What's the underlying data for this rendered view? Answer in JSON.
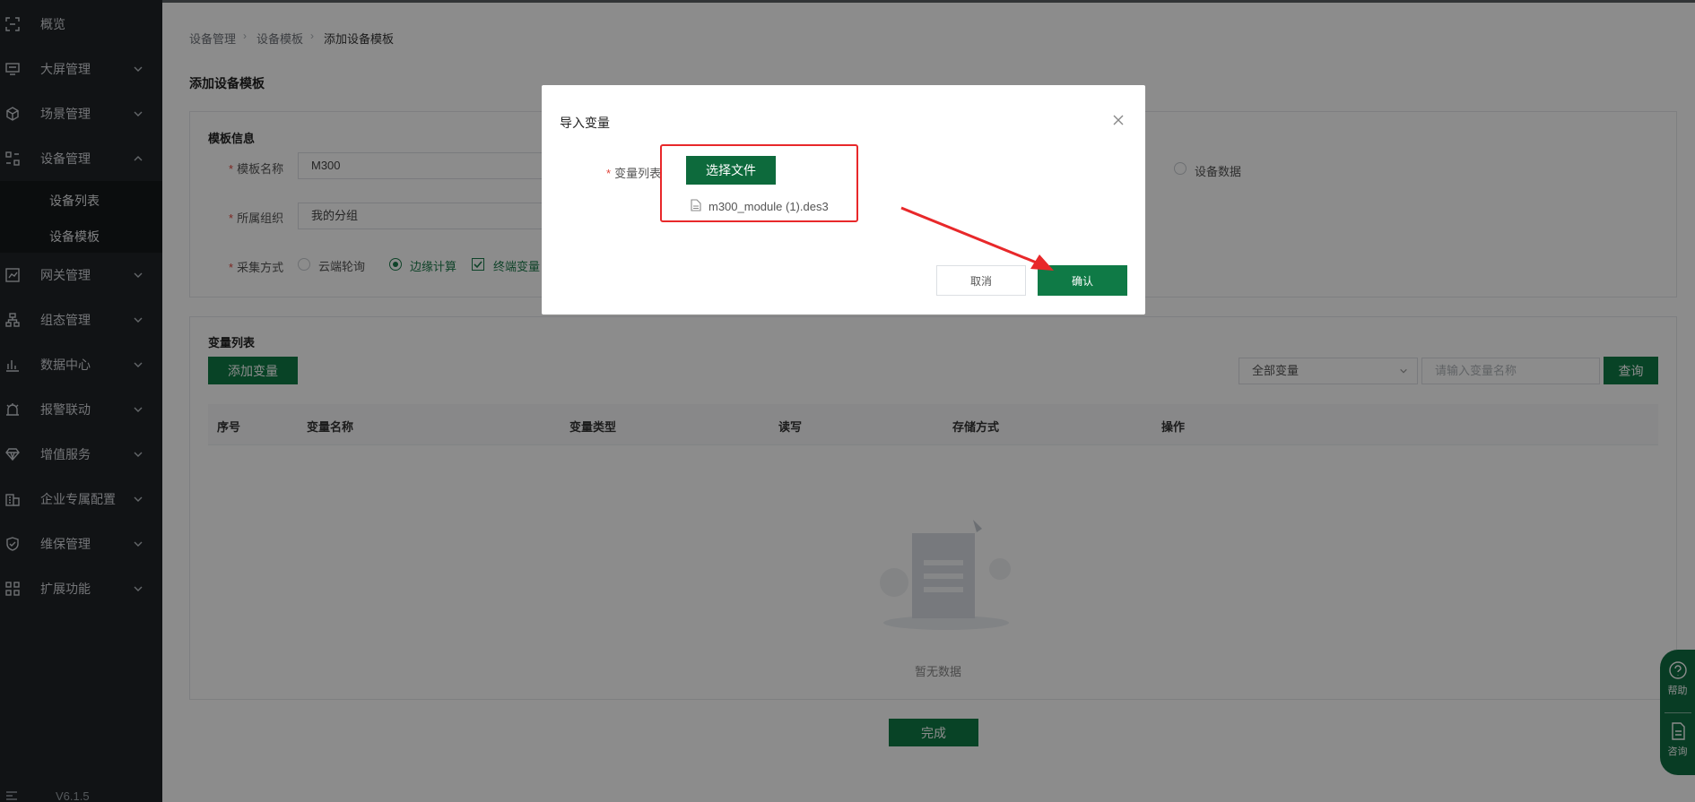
{
  "sidebar": {
    "items": [
      {
        "label": "概览",
        "icon": "scan-icon"
      },
      {
        "label": "大屏管理",
        "icon": "monitor-icon"
      },
      {
        "label": "场景管理",
        "icon": "cube-icon"
      },
      {
        "label": "设备管理",
        "icon": "device-grid-icon"
      },
      {
        "label": "网关管理",
        "icon": "chart-box-icon"
      },
      {
        "label": "组态管理",
        "icon": "hierarchy-icon"
      },
      {
        "label": "数据中心",
        "icon": "bar-chart-icon"
      },
      {
        "label": "报警联动",
        "icon": "alarm-icon"
      },
      {
        "label": "增值服务",
        "icon": "diamond-icon"
      },
      {
        "label": "企业专属配置",
        "icon": "building-icon"
      },
      {
        "label": "维保管理",
        "icon": "shield-icon"
      },
      {
        "label": "扩展功能",
        "icon": "apps-icon"
      }
    ],
    "sub_items": [
      "设备列表",
      "设备模板"
    ],
    "version": "V6.1.5"
  },
  "breadcrumb": [
    "设备管理",
    "设备模板",
    "添加设备模板"
  ],
  "page_title": "添加设备模板",
  "template_info": {
    "title": "模板信息",
    "name_label": "模板名称",
    "name_value": "M300",
    "org_label": "所属组织",
    "org_value": "我的分组",
    "mode_label": "采集方式",
    "mode_cloud": "云端轮询",
    "mode_edge": "边缘计算",
    "terminal_var": "终端变量",
    "device_data": "设备数据"
  },
  "var_list": {
    "title": "变量列表",
    "add_button": "添加变量",
    "filter_value": "全部变量",
    "search_placeholder": "请输入变量名称",
    "query_button": "查询",
    "columns": [
      "序号",
      "变量名称",
      "变量类型",
      "读写",
      "存储方式",
      "操作"
    ],
    "empty_text": "暂无数据"
  },
  "finish_button": "完成",
  "modal": {
    "title": "导入变量",
    "field_label": "变量列表",
    "choose_file": "选择文件",
    "file_name": "m300_module (1).des3",
    "cancel": "取消",
    "confirm": "确认"
  },
  "float_help": {
    "help": "帮助",
    "consult": "咨询"
  },
  "colors": {
    "accent": "#0f7a46",
    "sidebar_bg": "#1f2327",
    "highlight": "#e8282a"
  }
}
